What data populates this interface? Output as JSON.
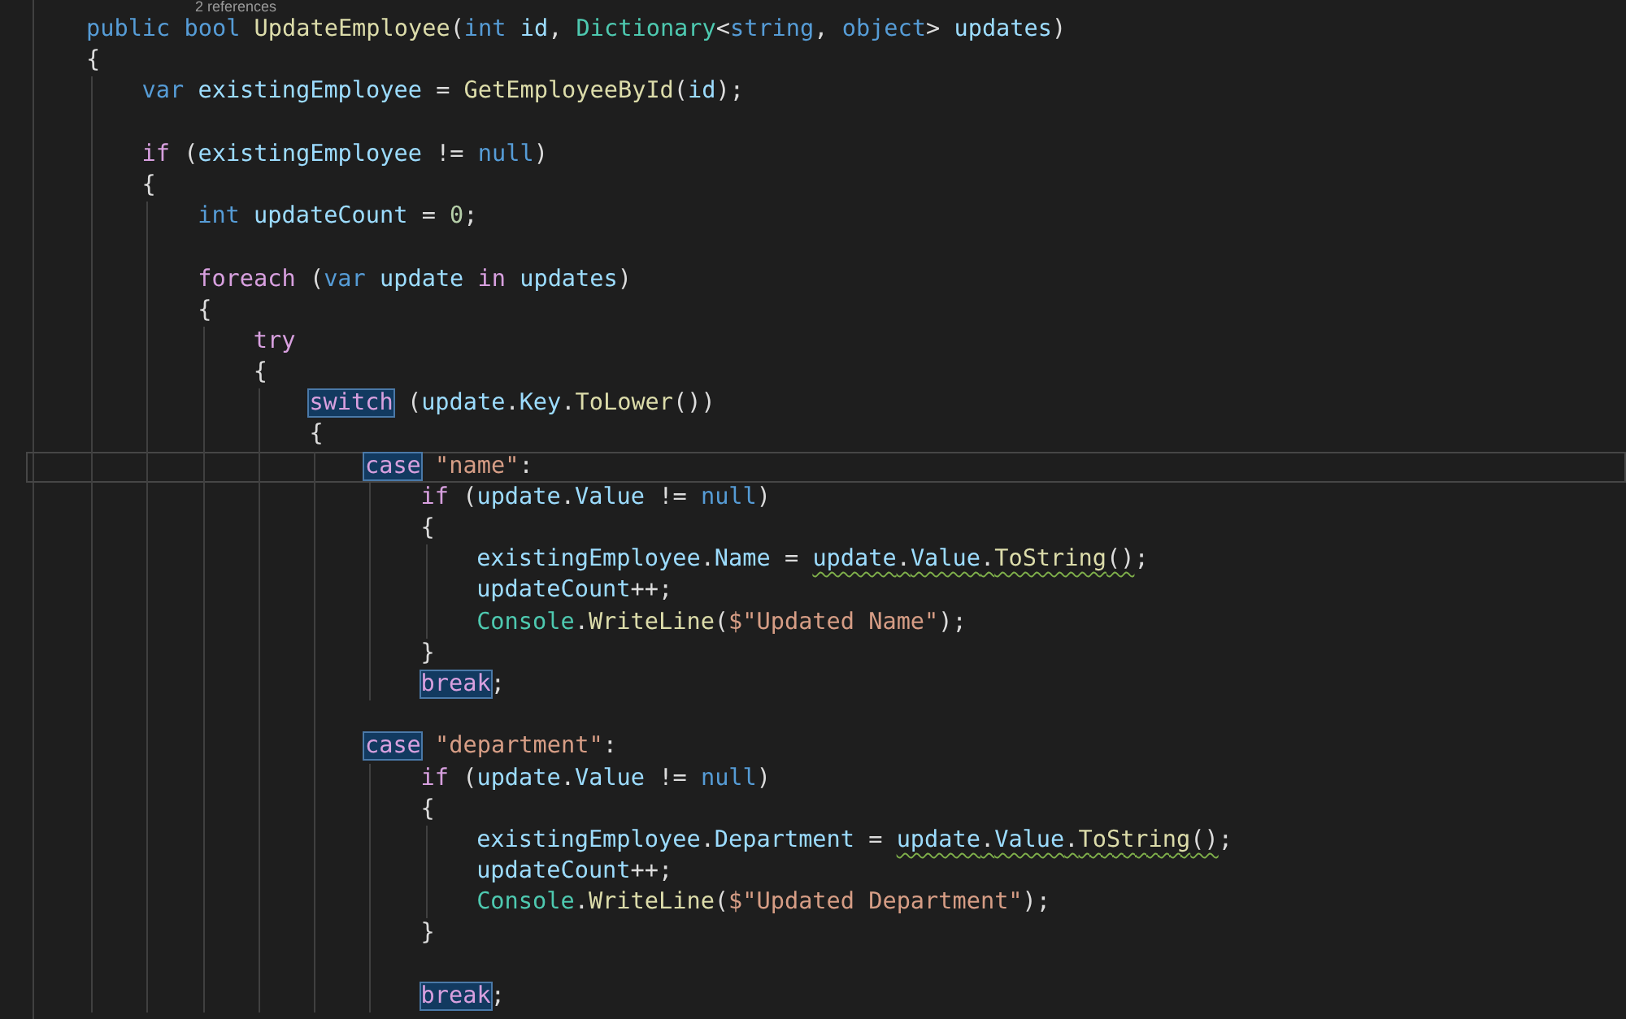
{
  "codelens": "2 references",
  "lines": [
    {
      "current": false,
      "tokens": [
        {
          "text": "public bool ",
          "kind": "keyword"
        },
        {
          "text": "UpdateEmployee",
          "kind": "function"
        },
        {
          "text": "(",
          "kind": "plain"
        },
        {
          "text": "int ",
          "kind": "keyword"
        },
        {
          "text": "id",
          "kind": "variable"
        },
        {
          "text": ", ",
          "kind": "plain"
        },
        {
          "text": "Dictionary",
          "kind": "type"
        },
        {
          "text": "<",
          "kind": "plain"
        },
        {
          "text": "string",
          "kind": "keyword"
        },
        {
          "text": ", ",
          "kind": "plain"
        },
        {
          "text": "object",
          "kind": "keyword"
        },
        {
          "text": "> ",
          "kind": "plain"
        },
        {
          "text": "updates",
          "kind": "variable"
        },
        {
          "text": ")",
          "kind": "plain"
        }
      ]
    },
    {
      "current": false,
      "tokens": [
        {
          "text": "{",
          "kind": "plain"
        }
      ],
      "children": [
        {
          "current": false,
          "tokens": [
            {
              "text": "var ",
              "kind": "keyword"
            },
            {
              "text": "existingEmployee",
              "kind": "variable"
            },
            {
              "text": " = ",
              "kind": "plain"
            },
            {
              "text": "GetEmployeeById",
              "kind": "function"
            },
            {
              "text": "(",
              "kind": "plain"
            },
            {
              "text": "id",
              "kind": "variable"
            },
            {
              "text": ");",
              "kind": "plain"
            }
          ]
        },
        {
          "current": false
        },
        {
          "current": false,
          "tokens": [
            {
              "text": "if",
              "kind": "control"
            },
            {
              "text": " (",
              "kind": "plain"
            },
            {
              "text": "existingEmployee",
              "kind": "variable"
            },
            {
              "text": " != ",
              "kind": "plain"
            },
            {
              "text": "null",
              "kind": "keyword"
            },
            {
              "text": ")",
              "kind": "plain"
            }
          ]
        },
        {
          "current": false,
          "tokens": [
            {
              "text": "{",
              "kind": "plain"
            }
          ],
          "children": [
            {
              "current": false,
              "tokens": [
                {
                  "text": "int ",
                  "kind": "keyword"
                },
                {
                  "text": "updateCount",
                  "kind": "variable"
                },
                {
                  "text": " = ",
                  "kind": "plain"
                },
                {
                  "text": "0",
                  "kind": "number"
                },
                {
                  "text": ";",
                  "kind": "plain"
                }
              ]
            },
            {
              "current": false
            },
            {
              "current": false,
              "tokens": [
                {
                  "text": "foreach",
                  "kind": "control"
                },
                {
                  "text": " (",
                  "kind": "plain"
                },
                {
                  "text": "var ",
                  "kind": "keyword"
                },
                {
                  "text": "update",
                  "kind": "variable"
                },
                {
                  "text": " in ",
                  "kind": "control"
                },
                {
                  "text": "updates",
                  "kind": "variable"
                },
                {
                  "text": ")",
                  "kind": "plain"
                }
              ]
            },
            {
              "current": false,
              "tokens": [
                {
                  "text": "{",
                  "kind": "plain"
                }
              ],
              "children": [
                {
                  "current": false,
                  "tokens": [
                    {
                      "text": "try",
                      "kind": "control"
                    }
                  ]
                },
                {
                  "current": false,
                  "tokens": [
                    {
                      "text": "{",
                      "kind": "plain"
                    }
                  ],
                  "children": [
                    {
                      "current": false,
                      "tokens": [
                        {
                          "text": "switch",
                          "kind": "control",
                          "highlighted": true
                        },
                        {
                          "text": " (",
                          "kind": "plain"
                        },
                        {
                          "text": "update",
                          "kind": "variable"
                        },
                        {
                          "text": ".",
                          "kind": "plain"
                        },
                        {
                          "text": "Key",
                          "kind": "variable"
                        },
                        {
                          "text": ".",
                          "kind": "plain"
                        },
                        {
                          "text": "ToLower",
                          "kind": "function"
                        },
                        {
                          "text": "())",
                          "kind": "plain"
                        }
                      ]
                    },
                    {
                      "current": false,
                      "tokens": [
                        {
                          "text": "{",
                          "kind": "plain"
                        }
                      ],
                      "children": [
                        {
                          "current": true,
                          "tokens": [
                            {
                              "text": "case",
                              "kind": "control",
                              "highlighted": true
                            },
                            {
                              "text": " \"name\"",
                              "kind": "string"
                            },
                            {
                              "text": ":",
                              "kind": "plain"
                            }
                          ],
                          "children": [
                            {
                              "current": false,
                              "tokens": [
                                {
                                  "text": "if",
                                  "kind": "control"
                                },
                                {
                                  "text": " (",
                                  "kind": "plain"
                                },
                                {
                                  "text": "update",
                                  "kind": "variable"
                                },
                                {
                                  "text": ".",
                                  "kind": "plain"
                                },
                                {
                                  "text": "Value",
                                  "kind": "variable"
                                },
                                {
                                  "text": " != ",
                                  "kind": "plain"
                                },
                                {
                                  "text": "null",
                                  "kind": "keyword"
                                },
                                {
                                  "text": ")",
                                  "kind": "plain"
                                }
                              ]
                            },
                            {
                              "current": false,
                              "tokens": [
                                {
                                  "text": "{",
                                  "kind": "plain"
                                }
                              ],
                              "children": [
                                {
                                  "current": false,
                                  "tokens": [
                                    {
                                      "text": "existingEmployee",
                                      "kind": "variable"
                                    },
                                    {
                                      "text": ".",
                                      "kind": "plain"
                                    },
                                    {
                                      "text": "Name",
                                      "kind": "variable"
                                    },
                                    {
                                      "text": " = ",
                                      "kind": "plain"
                                    },
                                    {
                                      "text": "update",
                                      "kind": "variable",
                                      "squiggle": true
                                    },
                                    {
                                      "text": ".",
                                      "kind": "plain",
                                      "squiggle": true
                                    },
                                    {
                                      "text": "Value",
                                      "kind": "variable",
                                      "squiggle": true
                                    },
                                    {
                                      "text": ".",
                                      "kind": "plain",
                                      "squiggle": true
                                    },
                                    {
                                      "text": "ToString",
                                      "kind": "function",
                                      "squiggle": true
                                    },
                                    {
                                      "text": "()",
                                      "kind": "plain",
                                      "squiggle": true
                                    },
                                    {
                                      "text": ";",
                                      "kind": "plain"
                                    }
                                  ]
                                },
                                {
                                  "current": false,
                                  "tokens": [
                                    {
                                      "text": "updateCount",
                                      "kind": "variable"
                                    },
                                    {
                                      "text": "++;",
                                      "kind": "plain"
                                    }
                                  ]
                                },
                                {
                                  "current": false,
                                  "tokens": [
                                    {
                                      "text": "Console",
                                      "kind": "type"
                                    },
                                    {
                                      "text": ".",
                                      "kind": "plain"
                                    },
                                    {
                                      "text": "WriteLine",
                                      "kind": "function"
                                    },
                                    {
                                      "text": "(",
                                      "kind": "plain"
                                    },
                                    {
                                      "text": "$\"Updated Name\"",
                                      "kind": "string"
                                    },
                                    {
                                      "text": ");",
                                      "kind": "plain"
                                    }
                                  ]
                                }
                              ]
                            },
                            {
                              "current": false,
                              "tokens": [
                                {
                                  "text": "}",
                                  "kind": "plain"
                                }
                              ]
                            },
                            {
                              "current": false,
                              "tokens": [
                                {
                                  "text": "break",
                                  "kind": "control",
                                  "highlighted": true
                                },
                                {
                                  "text": ";",
                                  "kind": "plain"
                                }
                              ]
                            }
                          ]
                        },
                        {
                          "current": false
                        },
                        {
                          "current": false,
                          "tokens": [
                            {
                              "text": "case",
                              "kind": "control",
                              "highlighted": true
                            },
                            {
                              "text": " \"department\"",
                              "kind": "string"
                            },
                            {
                              "text": ":",
                              "kind": "plain"
                            }
                          ],
                          "children": [
                            {
                              "current": false,
                              "tokens": [
                                {
                                  "text": "if",
                                  "kind": "control"
                                },
                                {
                                  "text": " (",
                                  "kind": "plain"
                                },
                                {
                                  "text": "update",
                                  "kind": "variable"
                                },
                                {
                                  "text": ".",
                                  "kind": "plain"
                                },
                                {
                                  "text": "Value",
                                  "kind": "variable"
                                },
                                {
                                  "text": " != ",
                                  "kind": "plain"
                                },
                                {
                                  "text": "null",
                                  "kind": "keyword"
                                },
                                {
                                  "text": ")",
                                  "kind": "plain"
                                }
                              ]
                            },
                            {
                              "current": false,
                              "tokens": [
                                {
                                  "text": "{",
                                  "kind": "plain"
                                }
                              ],
                              "children": [
                                {
                                  "current": false,
                                  "tokens": [
                                    {
                                      "text": "existingEmployee",
                                      "kind": "variable"
                                    },
                                    {
                                      "text": ".",
                                      "kind": "plain"
                                    },
                                    {
                                      "text": "Department",
                                      "kind": "variable"
                                    },
                                    {
                                      "text": " = ",
                                      "kind": "plain"
                                    },
                                    {
                                      "text": "update",
                                      "kind": "variable",
                                      "squiggle": true
                                    },
                                    {
                                      "text": ".",
                                      "kind": "plain",
                                      "squiggle": true
                                    },
                                    {
                                      "text": "Value",
                                      "kind": "variable",
                                      "squiggle": true
                                    },
                                    {
                                      "text": ".",
                                      "kind": "plain",
                                      "squiggle": true
                                    },
                                    {
                                      "text": "ToString",
                                      "kind": "function",
                                      "squiggle": true
                                    },
                                    {
                                      "text": "()",
                                      "kind": "plain",
                                      "squiggle": true
                                    },
                                    {
                                      "text": ";",
                                      "kind": "plain"
                                    }
                                  ]
                                },
                                {
                                  "current": false,
                                  "tokens": [
                                    {
                                      "text": "updateCount",
                                      "kind": "variable"
                                    },
                                    {
                                      "text": "++;",
                                      "kind": "plain"
                                    }
                                  ]
                                },
                                {
                                  "current": false,
                                  "tokens": [
                                    {
                                      "text": "Console",
                                      "kind": "type"
                                    },
                                    {
                                      "text": ".",
                                      "kind": "plain"
                                    },
                                    {
                                      "text": "WriteLine",
                                      "kind": "function"
                                    },
                                    {
                                      "text": "(",
                                      "kind": "plain"
                                    },
                                    {
                                      "text": "$\"Updated Department\"",
                                      "kind": "string"
                                    },
                                    {
                                      "text": ");",
                                      "kind": "plain"
                                    }
                                  ]
                                }
                              ]
                            },
                            {
                              "current": false,
                              "tokens": [
                                {
                                  "text": "}",
                                  "kind": "plain"
                                }
                              ]
                            },
                            {
                              "current": false
                            },
                            {
                              "current": false,
                              "tokens": [
                                {
                                  "text": "break",
                                  "kind": "control",
                                  "highlighted": true
                                },
                                {
                                  "text": ";",
                                  "kind": "plain"
                                }
                              ]
                            }
                          ]
                        }
                      ]
                    }
                  ]
                }
              ]
            }
          ]
        }
      ]
    }
  ]
}
